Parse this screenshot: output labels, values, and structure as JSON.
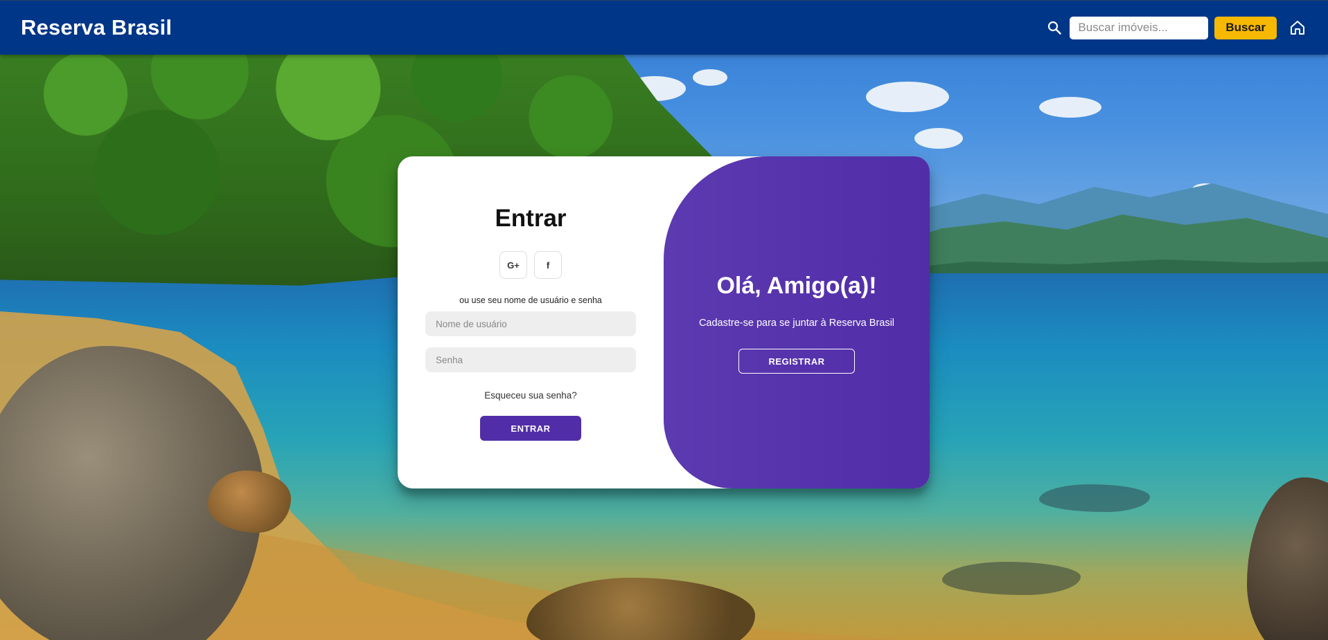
{
  "navbar": {
    "brand": "Reserva Brasil",
    "search_placeholder": "Buscar imóveis...",
    "search_button": "Buscar",
    "icons": {
      "search": "search-icon",
      "home": "home-icon"
    },
    "colors": {
      "bar": "#003687",
      "button": "#f6b800"
    }
  },
  "login": {
    "title": "Entrar",
    "social_google": "G+",
    "social_facebook": "f",
    "hint": "ou use seu nome de usuário e senha",
    "username_placeholder": "Nome de usuário",
    "password_placeholder": "Senha",
    "forgot": "Esqueceu sua senha?",
    "submit": "ENTRAR"
  },
  "welcome_panel": {
    "title": "Olá, Amigo(a)!",
    "text": "Cadastre-se para se juntar à Reserva Brasil",
    "button": "REGISTRAR",
    "color": "#512da8"
  }
}
